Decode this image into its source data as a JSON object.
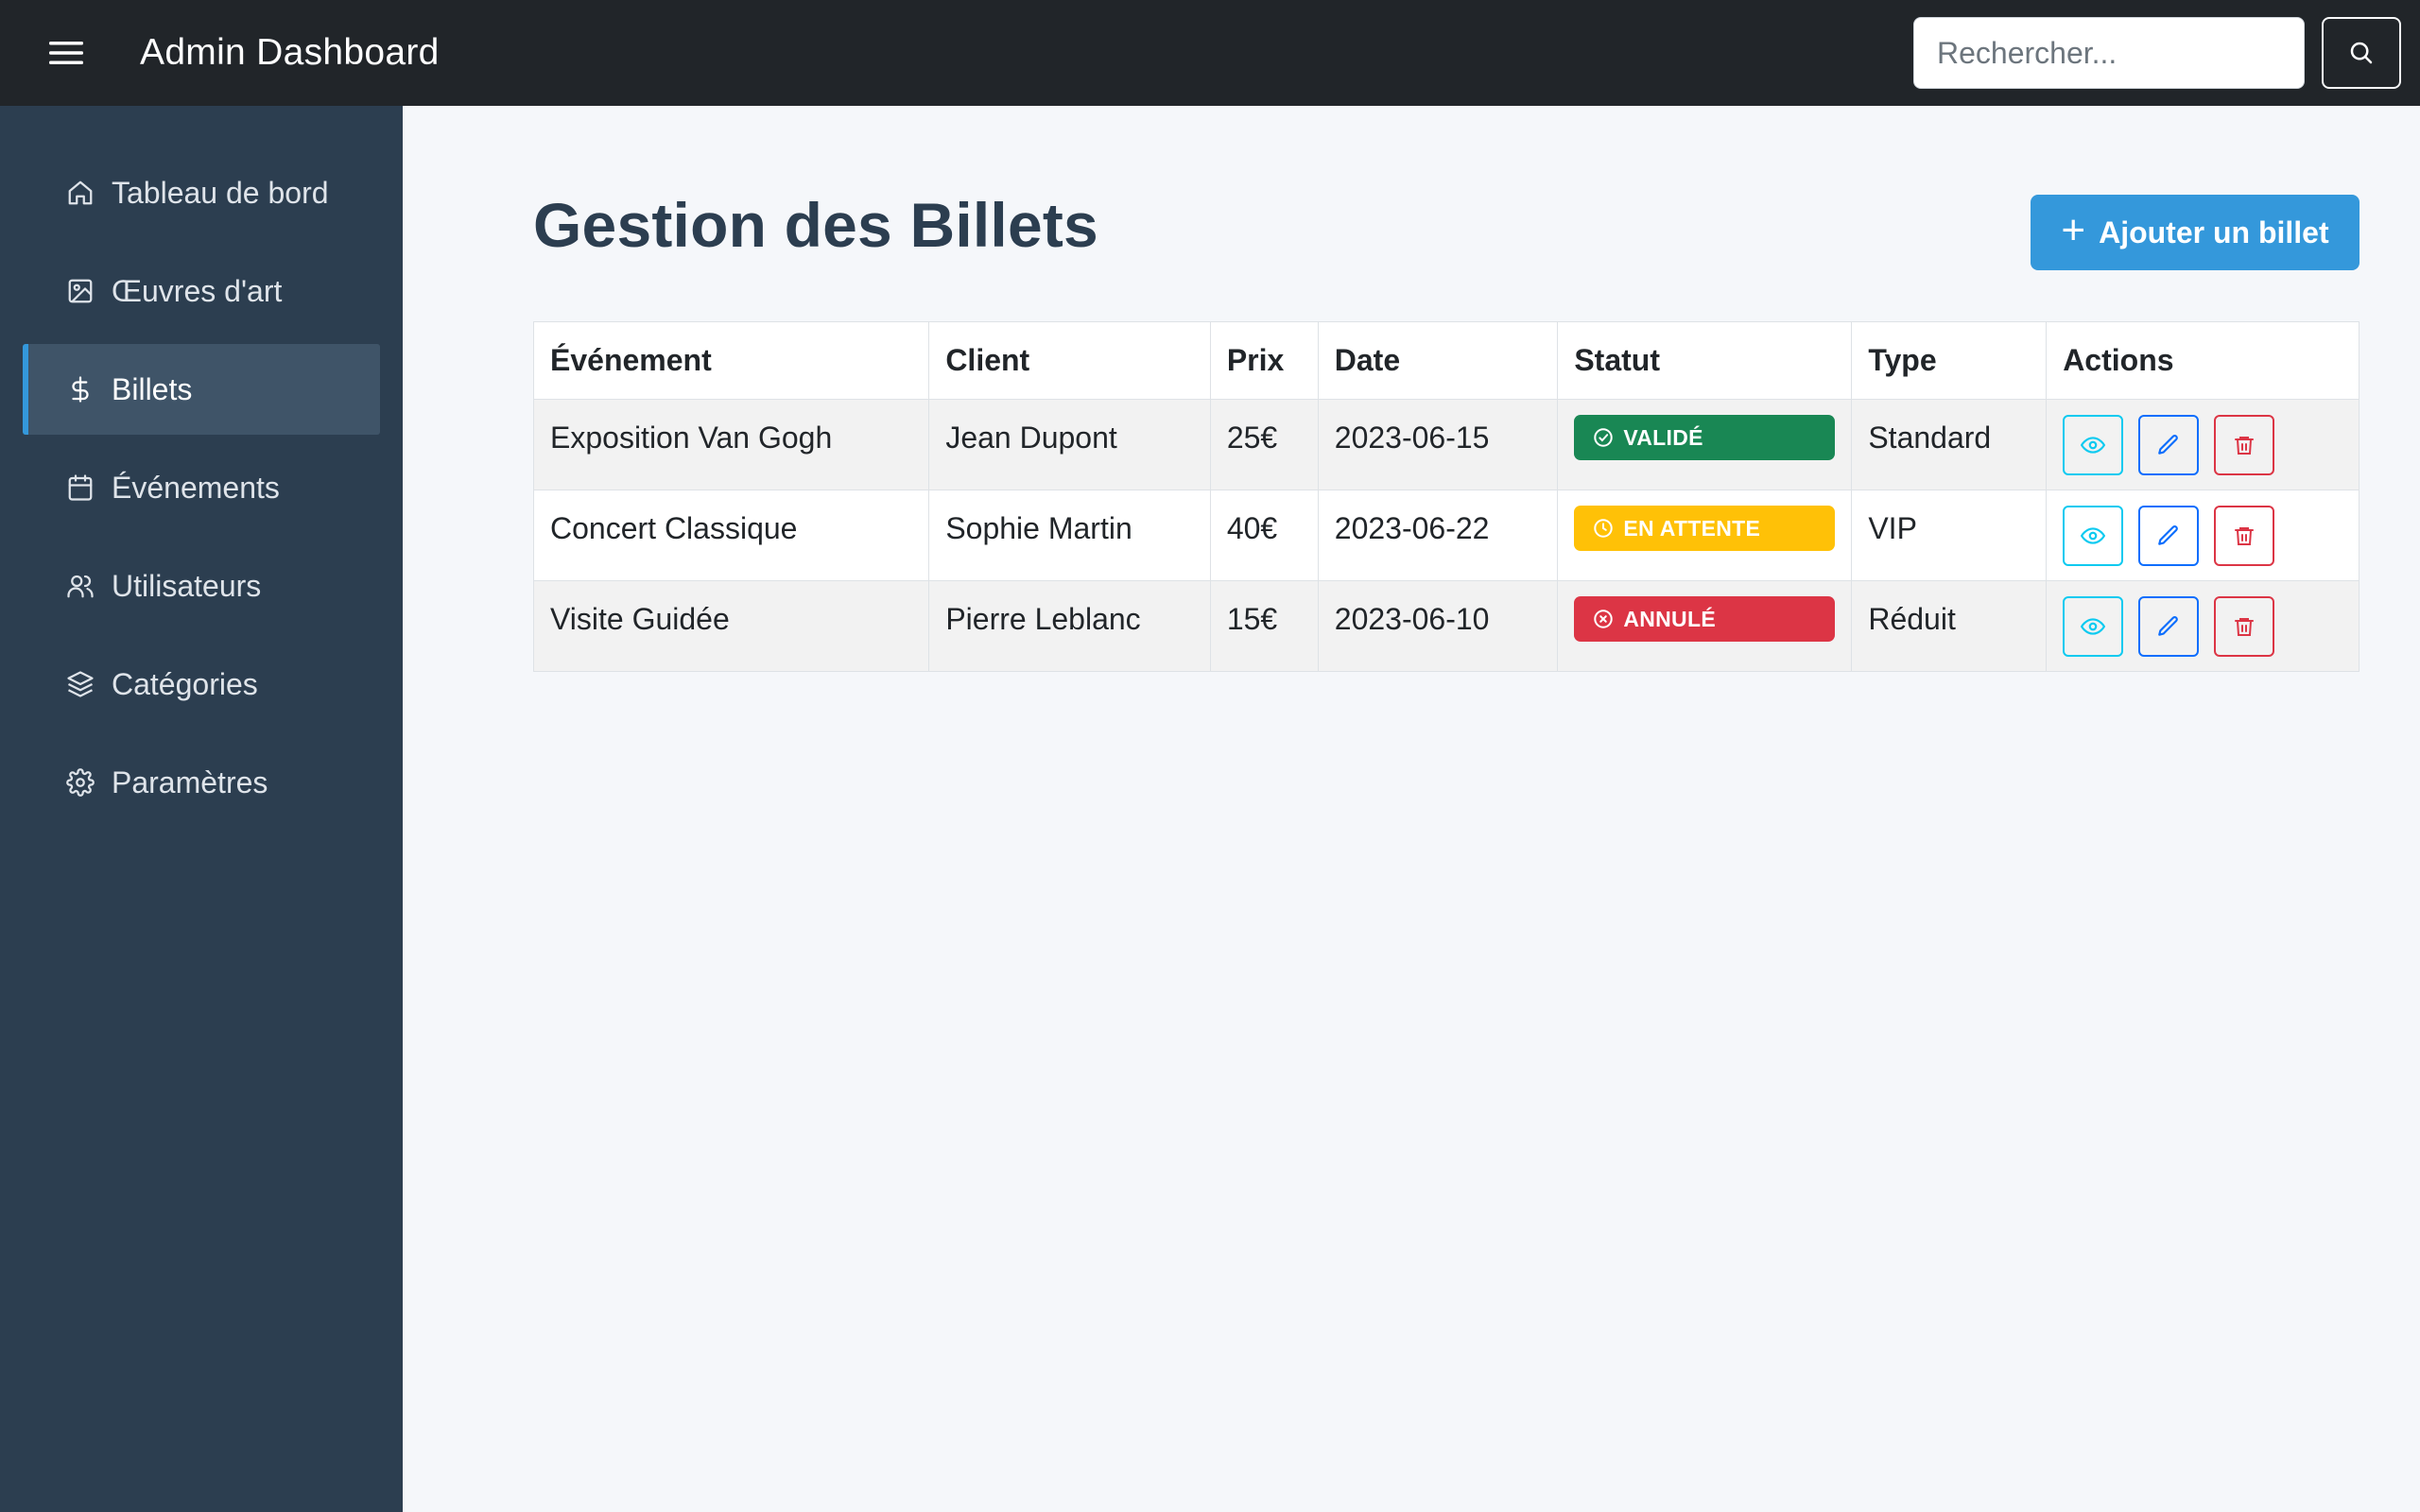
{
  "header": {
    "title": "Admin Dashboard",
    "search_placeholder": "Rechercher..."
  },
  "sidebar": {
    "items": [
      {
        "label": "Tableau de bord",
        "icon": "home-icon",
        "active": false
      },
      {
        "label": "Œuvres d'art",
        "icon": "image-icon",
        "active": false
      },
      {
        "label": "Billets",
        "icon": "dollar-icon",
        "active": true
      },
      {
        "label": "Événements",
        "icon": "calendar-icon",
        "active": false
      },
      {
        "label": "Utilisateurs",
        "icon": "users-icon",
        "active": false
      },
      {
        "label": "Catégories",
        "icon": "layers-icon",
        "active": false
      },
      {
        "label": "Paramètres",
        "icon": "gear-icon",
        "active": false
      }
    ]
  },
  "main": {
    "title": "Gestion des Billets",
    "add_button": "Ajouter un billet",
    "table": {
      "columns": [
        "Événement",
        "Client",
        "Prix",
        "Date",
        "Statut",
        "Type",
        "Actions"
      ],
      "rows": [
        {
          "event": "Exposition Van Gogh",
          "client": "Jean Dupont",
          "price": "25€",
          "date": "2023-06-15",
          "status": "VALIDÉ",
          "status_kind": "success",
          "type": "Standard"
        },
        {
          "event": "Concert Classique",
          "client": "Sophie Martin",
          "price": "40€",
          "date": "2023-06-22",
          "status": "EN ATTENTE",
          "status_kind": "warning",
          "type": "VIP"
        },
        {
          "event": "Visite Guidée",
          "client": "Pierre Leblanc",
          "price": "15€",
          "date": "2023-06-10",
          "status": "ANNULÉ",
          "status_kind": "danger",
          "type": "Réduit"
        }
      ]
    }
  },
  "colors": {
    "topbar": "#212529",
    "sidebar": "#2c3e50",
    "accent": "#3498db",
    "success": "#198754",
    "warning": "#ffc107",
    "danger": "#dc3545",
    "info": "#0dcaf0",
    "primary": "#0d6efd"
  }
}
